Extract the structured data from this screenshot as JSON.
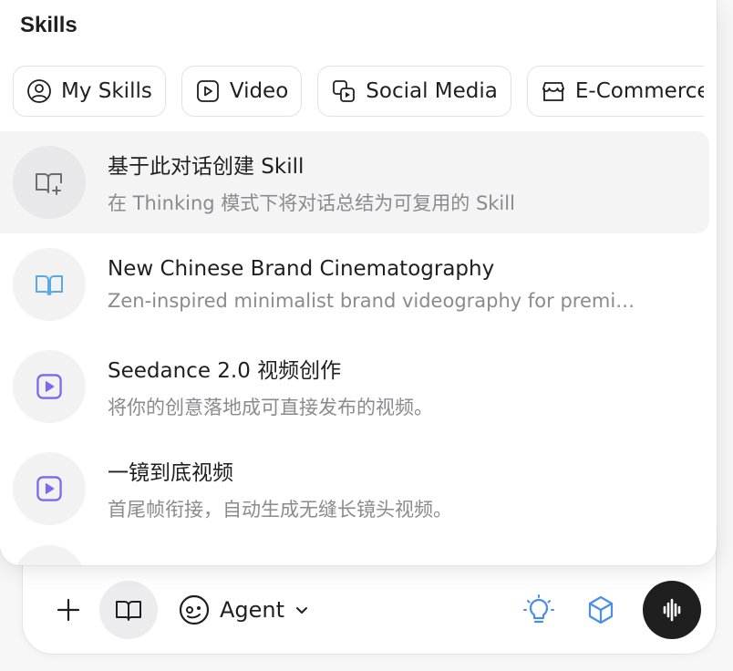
{
  "panel": {
    "title": "Skills",
    "chips": [
      {
        "label": "My Skills",
        "icon": "user-circle-icon"
      },
      {
        "label": "Video",
        "icon": "play-square-icon"
      },
      {
        "label": "Social Media",
        "icon": "social-media-icon"
      },
      {
        "label": "E-Commerce",
        "icon": "storefront-icon"
      }
    ],
    "items": [
      {
        "title": "基于此对话创建 Skill",
        "desc": "在 Thinking 模式下将对话总结为可复用的 Skill",
        "icon": "book-plus-icon",
        "active": true
      },
      {
        "title": "New Chinese Brand Cinematography",
        "desc": "Zen-inspired minimalist brand videography for premi…",
        "icon": "open-book-icon"
      },
      {
        "title": "Seedance 2.0 视频创作",
        "desc": "将你的创意落地成可直接发布的视频。",
        "icon": "play-square-icon"
      },
      {
        "title": "一镜到底视频",
        "desc": "首尾帧衔接，自动生成无缝长镜头视频。",
        "icon": "play-square-icon"
      }
    ]
  },
  "composer": {
    "agent_label": "Agent",
    "icons": [
      "plus-icon",
      "open-book-icon",
      "agent-face-icon",
      "chevron-down-icon",
      "lightbulb-icon",
      "cube-icon",
      "voice-wave-icon"
    ]
  },
  "colors": {
    "accent_blue": "#4a8ee8",
    "accent_purple": "#7b68ee",
    "book_blue": "#5aa9e6"
  }
}
